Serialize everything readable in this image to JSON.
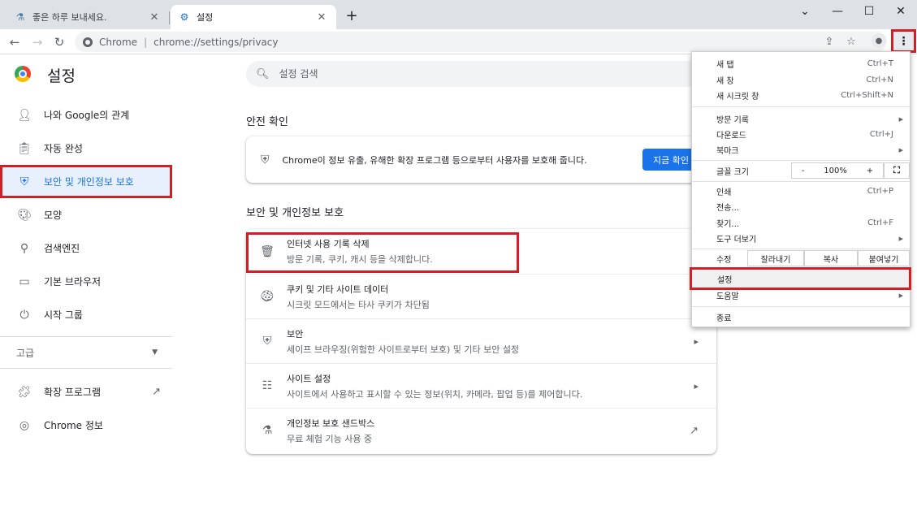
{
  "tabs": [
    {
      "title": "좋은 하루 보내세요.",
      "icon": "flask-icon"
    },
    {
      "title": "설정",
      "icon": "gear-icon"
    }
  ],
  "toolbar": {
    "chip": "Chrome",
    "url": "chrome://settings/privacy"
  },
  "settings": {
    "title": "설정",
    "search_placeholder": "설정 검색"
  },
  "sidebar": {
    "items": [
      {
        "label": "나와 Google의 관계",
        "icon": "person-icon"
      },
      {
        "label": "자동 완성",
        "icon": "clipboard-icon"
      },
      {
        "label": "보안 및 개인정보 보호",
        "icon": "shield-icon"
      },
      {
        "label": "모양",
        "icon": "palette-icon"
      },
      {
        "label": "검색엔진",
        "icon": "search-icon"
      },
      {
        "label": "기본 브라우저",
        "icon": "browser-icon"
      },
      {
        "label": "시작 그룹",
        "icon": "power-icon"
      }
    ],
    "advanced": "고급",
    "extensions": "확장 프로그램",
    "about": "Chrome 정보"
  },
  "safety": {
    "section_title": "안전 확인",
    "text": "Chrome이 정보 유출, 유해한 확장 프로그램 등으로부터 사용자를 보호해 줍니다.",
    "button": "지금 확인"
  },
  "privacy": {
    "section_title": "보안 및 개인정보 보호",
    "rows": [
      {
        "title": "인터넷 사용 기록 삭제",
        "sub": "방문 기록, 쿠키, 캐시 등을 삭제합니다."
      },
      {
        "title": "쿠키 및 기타 사이트 데이터",
        "sub": "시크릿 모드에서는 타사 쿠키가 차단됨"
      },
      {
        "title": "보안",
        "sub": "세이프 브라우징(위험한 사이트로부터 보호) 및 기타 보안 설정"
      },
      {
        "title": "사이트 설정",
        "sub": "사이트에서 사용하고 표시할 수 있는 정보(위치, 카메라, 팝업 등)를 제어합니다."
      },
      {
        "title": "개인정보 보호 샌드박스",
        "sub": "무료 체험 기능 사용 중"
      }
    ]
  },
  "menu": {
    "new_tab": "새 탭",
    "new_tab_sc": "Ctrl+T",
    "new_window": "새 창",
    "new_window_sc": "Ctrl+N",
    "incognito": "새 시크릿 창",
    "incognito_sc": "Ctrl+Shift+N",
    "history": "방문 기록",
    "downloads": "다운로드",
    "downloads_sc": "Ctrl+J",
    "bookmarks": "북마크",
    "zoom_label": "글꼴 크기",
    "zoom_minus": "-",
    "zoom_value": "100%",
    "zoom_plus": "+",
    "print": "인쇄",
    "print_sc": "Ctrl+P",
    "cast": "전송...",
    "find": "찾기...",
    "find_sc": "Ctrl+F",
    "more_tools": "도구 더보기",
    "edit": "수정",
    "cut": "잘라내기",
    "copy": "복사",
    "paste": "붙여넣기",
    "settings": "설정",
    "help": "도움말",
    "exit": "종료"
  }
}
